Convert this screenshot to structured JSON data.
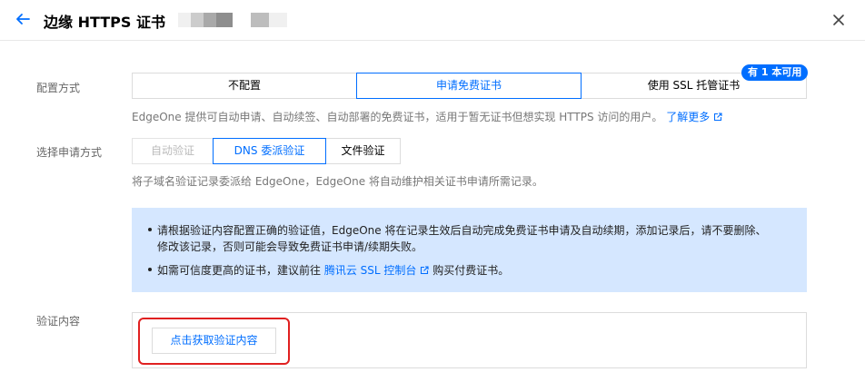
{
  "header": {
    "title": "边缘 HTTPS 证书"
  },
  "config": {
    "label": "配置方式",
    "options": [
      "不配置",
      "申请免费证书",
      "使用 SSL 托管证书"
    ],
    "badge": "有 1 本可用",
    "description": "EdgeOne 提供可自动申请、自动续签、自动部署的免费证书，适用于暂无证书但想实现 HTTPS 访问的用户。",
    "learn_more": "了解更多"
  },
  "apply_method": {
    "label": "选择申请方式",
    "options": [
      "自动验证",
      "DNS 委派验证",
      "文件验证"
    ],
    "description": "将子域名验证记录委派给 EdgeOne，EdgeOne 将自动维护相关证书申请所需记录。"
  },
  "notice": {
    "line1": "请根据验证内容配置正确的验证值，EdgeOne 将在记录生效后自动完成免费证书申请及自动续期，添加记录后，请不要删除、",
    "line2": "修改该记录，否则可能会导致免费证书申请/续期失败。",
    "line3_prefix": "如需可信度更高的证书，建议前往",
    "line3_link": "腾讯云 SSL 控制台",
    "line3_suffix": "购买付费证书。"
  },
  "verify": {
    "label": "验证内容",
    "button": "点击获取验证内容"
  },
  "colors": {
    "accent": "#006eff",
    "notice_bg": "#d5e7ff",
    "highlight": "#e02020"
  }
}
